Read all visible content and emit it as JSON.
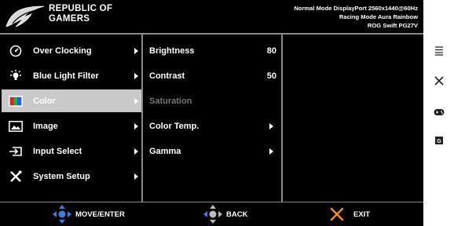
{
  "header": {
    "brand_line1": "REPUBLIC OF",
    "brand_line2": "GAMERS",
    "status_line1": "Normal Mode DisplayPort 2560x1440@60Hz",
    "status_line2": "Racing Mode Aura Rainbow",
    "status_line3": "ROG Swift PG27V"
  },
  "main_menu": [
    {
      "label": "Over Clocking",
      "icon": "speedometer-icon",
      "selected": false
    },
    {
      "label": "Blue Light Filter",
      "icon": "light-bulb-icon",
      "selected": false
    },
    {
      "label": "Color",
      "icon": "color-bars-icon",
      "selected": true
    },
    {
      "label": "Image",
      "icon": "image-icon",
      "selected": false
    },
    {
      "label": "Input Select",
      "icon": "input-icon",
      "selected": false
    },
    {
      "label": "System Setup",
      "icon": "tools-icon",
      "selected": false
    }
  ],
  "submenu": [
    {
      "label": "Brightness",
      "value": "80",
      "enabled": true
    },
    {
      "label": "Contrast",
      "value": "50",
      "enabled": true
    },
    {
      "label": "Saturation",
      "value": "",
      "enabled": false
    },
    {
      "label": "Color Temp.",
      "value": "",
      "enabled": true,
      "arrow": true
    },
    {
      "label": "Gamma",
      "value": "",
      "enabled": true,
      "arrow": true
    }
  ],
  "footer": {
    "move_label": "MOVE/ENTER",
    "back_label": "BACK",
    "exit_label": "EXIT"
  },
  "side_icons": [
    "menu-icon",
    "close-icon",
    "gamepad-icon",
    "gameplus-icon"
  ],
  "colors": {
    "background": "#000000",
    "selected": "#c9c9c9",
    "separator": "#8a8a8a",
    "accent_blue": "#3a7fe0",
    "exit_orange": "#f08a2a"
  }
}
